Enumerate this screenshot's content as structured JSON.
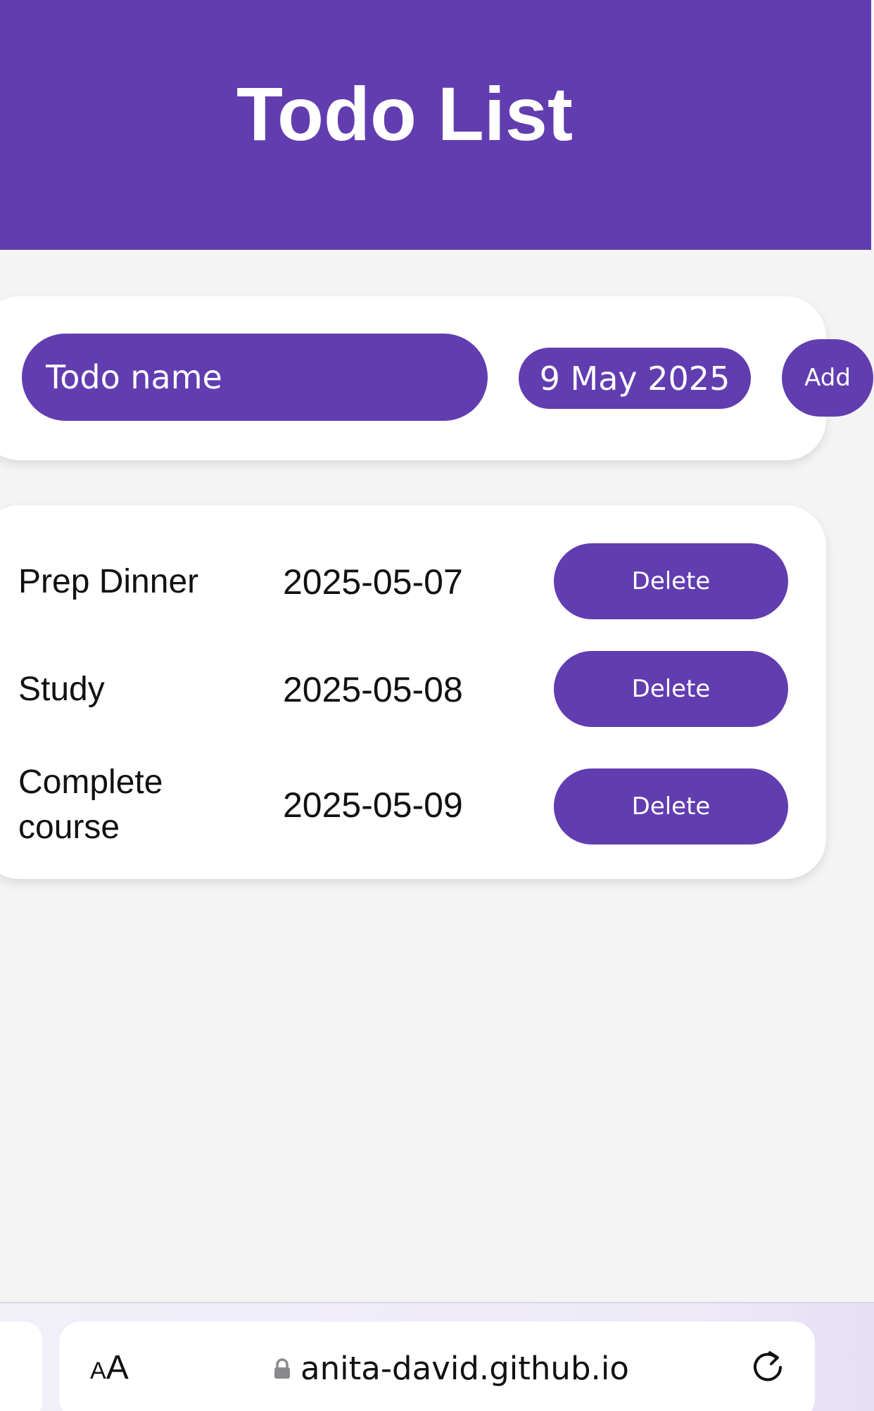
{
  "header": {
    "title": "Todo List"
  },
  "form": {
    "name_placeholder": "Todo name",
    "date_value": "9 May 2025",
    "add_label": "Add"
  },
  "todos": [
    {
      "name": "Prep Dinner",
      "date": "2025-05-07",
      "delete_label": "Delete"
    },
    {
      "name": "Study",
      "date": "2025-05-08",
      "delete_label": "Delete"
    },
    {
      "name": "Complete course",
      "date": "2025-05-09",
      "delete_label": "Delete"
    }
  ],
  "browser": {
    "text_size_small": "A",
    "text_size_large": "A",
    "url": "anita-david.github.io",
    "lock_icon": "lock-icon",
    "reload_icon": "reload-icon"
  },
  "colors": {
    "accent": "#613db0",
    "background": "#f4f4f4",
    "card": "#ffffff"
  }
}
